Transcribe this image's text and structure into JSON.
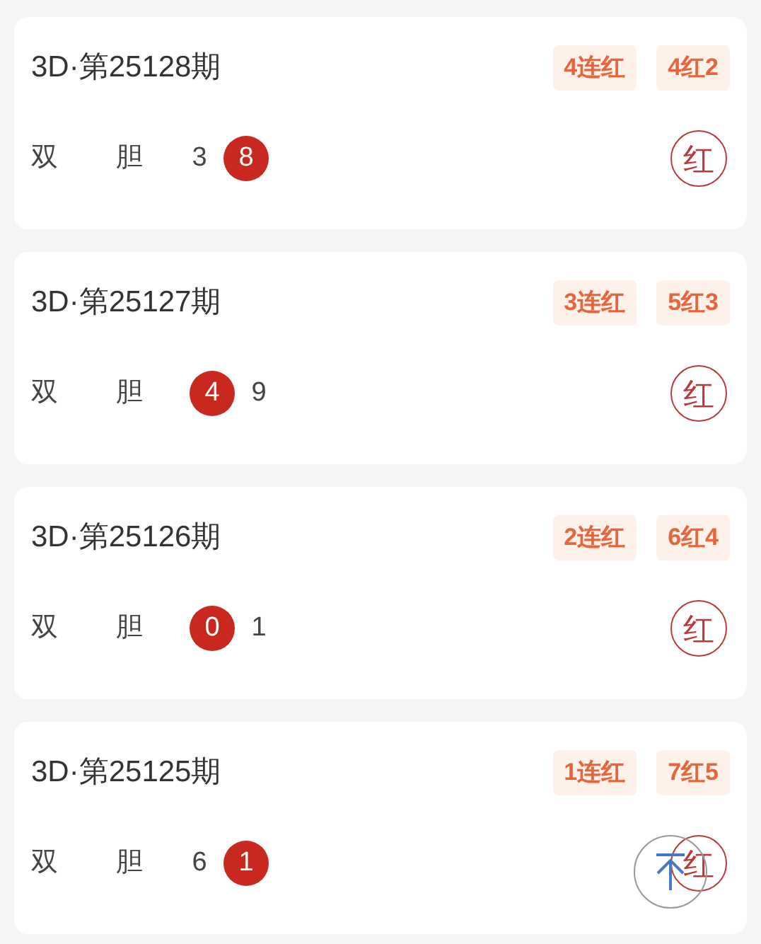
{
  "cards": [
    {
      "title": "3D·第25128期",
      "tags": [
        "4连红",
        "4红2"
      ],
      "label_1": "双",
      "label_2": "胆",
      "numbers": [
        {
          "value": "3",
          "hit": false
        },
        {
          "value": "8",
          "hit": true
        }
      ],
      "result": "红"
    },
    {
      "title": "3D·第25127期",
      "tags": [
        "3连红",
        "5红3"
      ],
      "label_1": "双",
      "label_2": "胆",
      "numbers": [
        {
          "value": "4",
          "hit": true
        },
        {
          "value": "9",
          "hit": false
        }
      ],
      "result": "红"
    },
    {
      "title": "3D·第25126期",
      "tags": [
        "2连红",
        "6红4"
      ],
      "label_1": "双",
      "label_2": "胆",
      "numbers": [
        {
          "value": "0",
          "hit": true
        },
        {
          "value": "1",
          "hit": false
        }
      ],
      "result": "红"
    },
    {
      "title": "3D·第25125期",
      "tags": [
        "1连红",
        "7红5"
      ],
      "label_1": "双",
      "label_2": "胆",
      "numbers": [
        {
          "value": "6",
          "hit": false
        },
        {
          "value": "1",
          "hit": true
        }
      ],
      "result": "红"
    }
  ]
}
